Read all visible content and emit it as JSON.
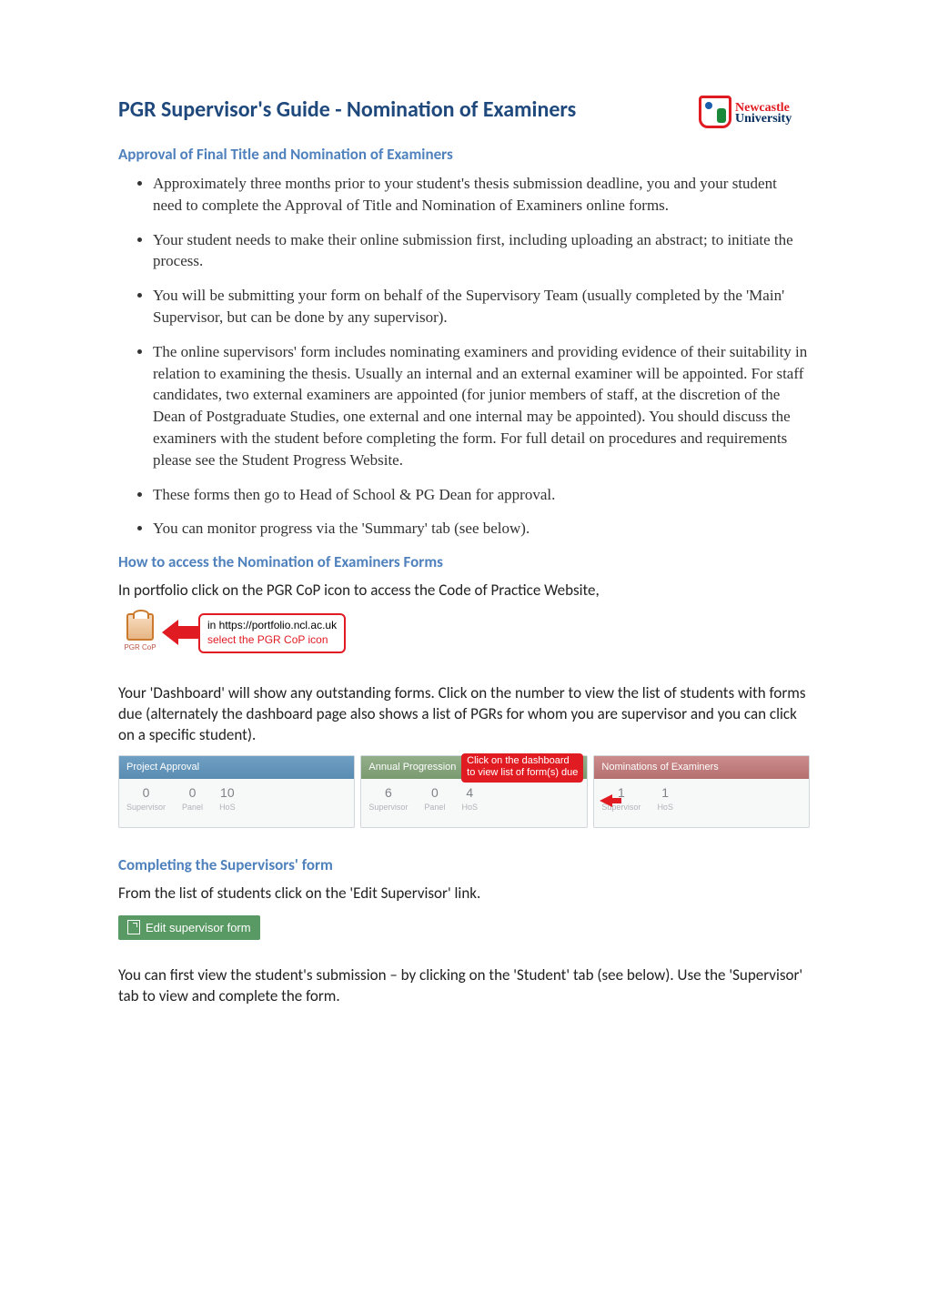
{
  "header": {
    "title": "PGR Supervisor's Guide - Nomination of Examiners",
    "logo": {
      "line1": "Newcastle",
      "line2": "University"
    }
  },
  "sections": {
    "approval": {
      "heading": "Approval of Final Title and Nomination of Examiners",
      "bullets": [
        "Approximately three months prior to your student's thesis submission deadline, you and your student need to complete the Approval of Title and Nomination of Examiners online forms.",
        "Your student needs to make their online submission first, including uploading an abstract; to initiate the process.",
        "You will be submitting your form on behalf of the Supervisory Team (usually completed by the 'Main' Supervisor, but can be done by any supervisor).",
        "The online supervisors' form includes nominating examiners and providing evidence of their suitability in relation to examining the thesis. Usually an internal and an external examiner will be appointed. For staff candidates, two external examiners are appointed (for junior members of staff, at the discretion of the Dean of Postgraduate Studies, one external and one internal may be appointed). You should discuss the examiners with the student before completing the form. For full detail on procedures and requirements please see the Student Progress Website.",
        "These forms then go to Head of School & PG Dean for approval.",
        "You can monitor progress via the 'Summary' tab (see below)."
      ]
    },
    "access": {
      "heading": "How to access the Nomination of Examiners Forms",
      "intro": "In portfolio click on the PGR CoP icon to access the Code of Practice Website,",
      "callout": {
        "icon_label": "PGR CoP",
        "line1": "in https://portfolio.ncl.ac.uk",
        "line2": "select the PGR CoP icon"
      },
      "para": "Your 'Dashboard' will show any outstanding forms. Click on the number to view the list of students with forms due (alternately the dashboard page also shows a list of PGRs for whom you are supervisor and you can click on a specific student)."
    },
    "dashboard": {
      "cards": [
        {
          "title": "Project Approval",
          "cols": [
            {
              "n": "0",
              "l": "Supervisor"
            },
            {
              "n": "0",
              "l": "Panel"
            },
            {
              "n": "10",
              "l": "HoS"
            }
          ]
        },
        {
          "title": "Annual Progression",
          "cols": [
            {
              "n": "6",
              "l": "Supervisor"
            },
            {
              "n": "0",
              "l": "Panel"
            },
            {
              "n": "4",
              "l": "HoS"
            }
          ]
        },
        {
          "title": "Nominations of Examiners",
          "cols": [
            {
              "n": "1",
              "l": "Supervisor"
            },
            {
              "n": "1",
              "l": "HoS"
            }
          ]
        }
      ],
      "callout": {
        "line1": "Click on the dashboard",
        "line2": "to view list of form(s) due"
      }
    },
    "completing": {
      "heading": "Completing the Supervisors' form",
      "intro": "From the list of students click on the 'Edit Supervisor' link.",
      "pill": "Edit supervisor form",
      "para": "You can first view the student's submission – by clicking on the 'Student' tab (see below). Use the 'Supervisor' tab to view and complete the form."
    }
  }
}
